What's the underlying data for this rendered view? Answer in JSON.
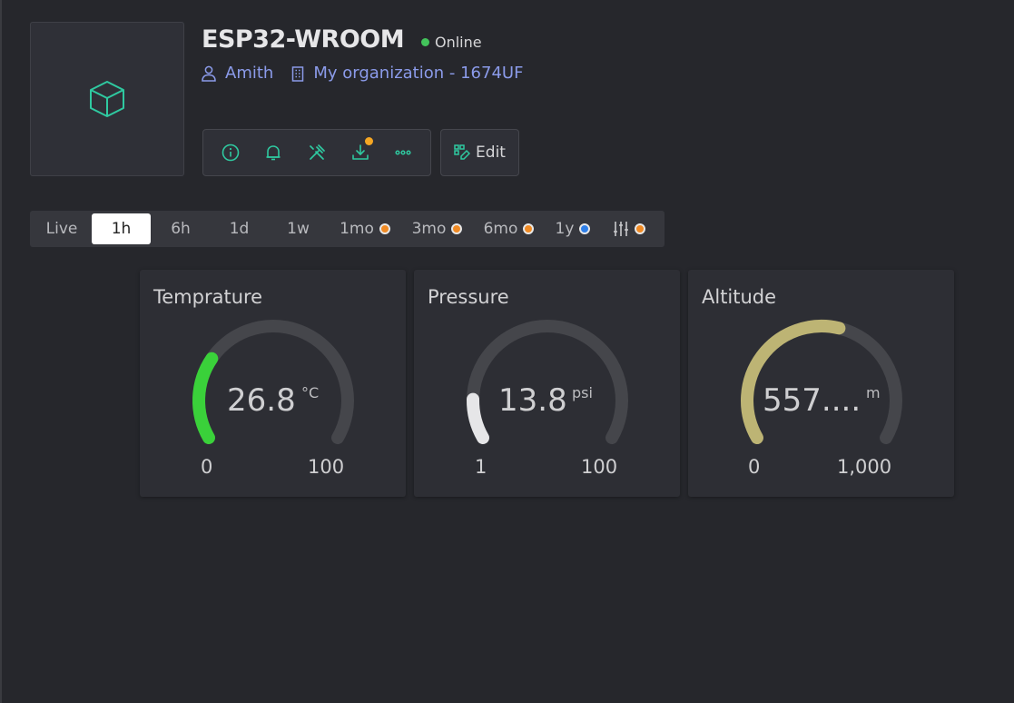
{
  "device": {
    "name": "ESP32-WROOM",
    "status": "Online",
    "status_color": "#43c35b",
    "owner": "Amith",
    "organization": "My organization - 1674UF",
    "thumbnail_icon": "cube-icon"
  },
  "toolbar": {
    "buttons": [
      {
        "icon": "info-icon"
      },
      {
        "icon": "bell-icon"
      },
      {
        "icon": "tools-icon"
      },
      {
        "icon": "download-icon",
        "badge": true
      },
      {
        "icon": "more-icon"
      }
    ],
    "edit_label": "Edit"
  },
  "time_ranges": {
    "items": [
      {
        "label": "Live",
        "active": false,
        "dot": null
      },
      {
        "label": "1h",
        "active": true,
        "dot": null
      },
      {
        "label": "6h",
        "active": false,
        "dot": null
      },
      {
        "label": "1d",
        "active": false,
        "dot": null
      },
      {
        "label": "1w",
        "active": false,
        "dot": null
      },
      {
        "label": "1mo",
        "active": false,
        "dot": "orange"
      },
      {
        "label": "3mo",
        "active": false,
        "dot": "orange"
      },
      {
        "label": "6mo",
        "active": false,
        "dot": "orange"
      },
      {
        "label": "1y",
        "active": false,
        "dot": "blue"
      }
    ],
    "custom_icon": "sliders-icon",
    "custom_dot": "orange"
  },
  "widgets": [
    {
      "title": "Temprature",
      "value": "26.8",
      "unit": "°C",
      "min": "0",
      "max": "100",
      "fraction": 0.268,
      "color": "#3ad13a"
    },
    {
      "title": "Pressure",
      "value": "13.8",
      "unit": "psi",
      "min": "1",
      "max": "100",
      "fraction": 0.129,
      "color": "#e6e6e8"
    },
    {
      "title": "Altitude",
      "value": "557....",
      "unit": "m",
      "min": "0",
      "max": "1,000",
      "fraction": 0.557,
      "color": "#bdb474"
    }
  ]
}
